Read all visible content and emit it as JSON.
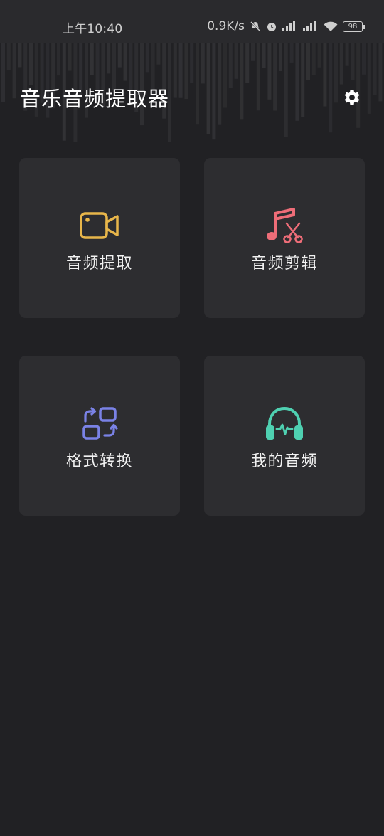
{
  "status_bar": {
    "time": "上午10:40",
    "net_speed": "0.9K/s",
    "battery": "98",
    "icons": [
      "mute-icon",
      "alarm-icon",
      "signal-icon",
      "signal-icon",
      "wifi-icon",
      "battery-icon"
    ]
  },
  "header": {
    "title": "音乐音频提取器",
    "settings_icon": "gear-icon"
  },
  "tiles": [
    {
      "label": "音频提取",
      "icon": "video-camera-icon",
      "color": "#e8b64a"
    },
    {
      "label": "音频剪辑",
      "icon": "music-scissors-icon",
      "color": "#ee6d78"
    },
    {
      "label": "格式转换",
      "icon": "convert-icon",
      "color": "#7a82e6"
    },
    {
      "label": "我的音频",
      "icon": "headphones-icon",
      "color": "#4fd0b1"
    }
  ],
  "colors": {
    "background": "#212124",
    "tile_background": "#2d2d30"
  }
}
